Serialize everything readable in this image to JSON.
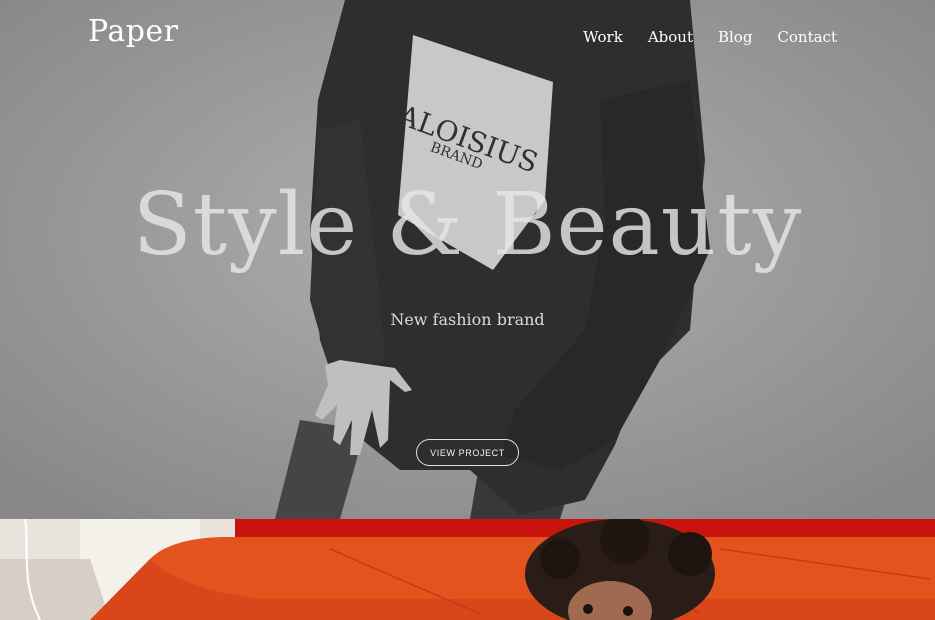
{
  "brand": {
    "logo_text": "Paper"
  },
  "nav": {
    "items": [
      {
        "label": "Work"
      },
      {
        "label": "About"
      },
      {
        "label": "Blog"
      },
      {
        "label": "Contact"
      }
    ]
  },
  "hero": {
    "headline": "Style & Beauty",
    "subheadline": "New fashion brand",
    "cta_label": "VIEW PROJECT",
    "sweatshirt_print": {
      "line1": "ALOISIUS",
      "line2": "BRAND"
    }
  },
  "colors": {
    "hero_gray": "#a9a9a9",
    "sofa_orange": "#e0501f",
    "wall_red": "#c31c14",
    "text_white": "#ffffff"
  }
}
